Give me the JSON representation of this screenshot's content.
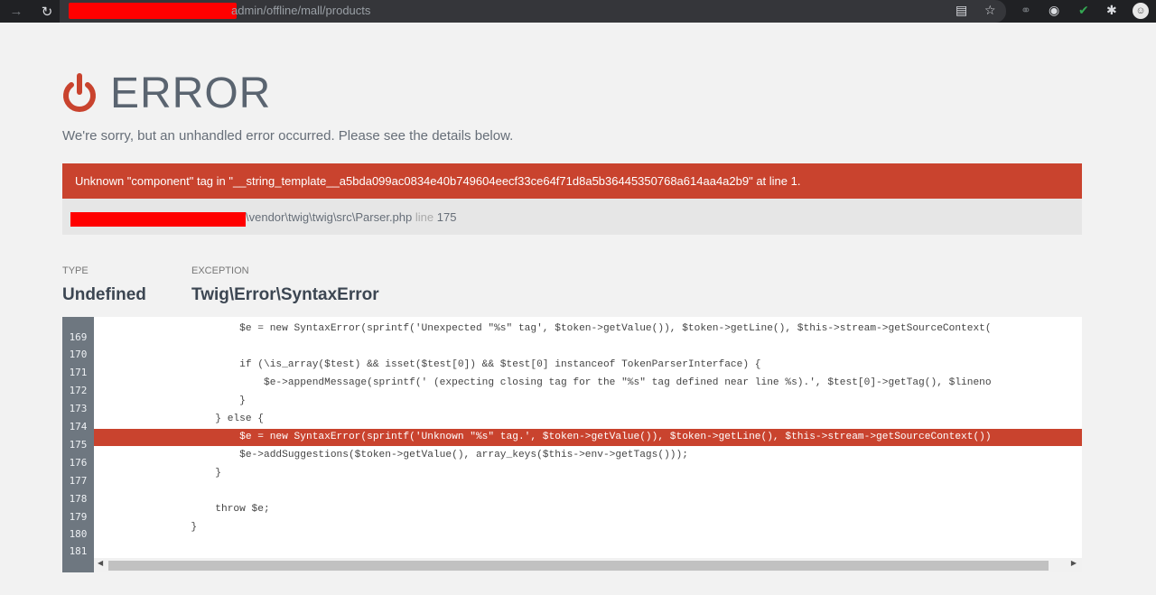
{
  "browser": {
    "url_path": "admin/offline/mall/products",
    "back_icon": "arrow-right",
    "reload_icon": "reload"
  },
  "error": {
    "title": "ERROR",
    "description": "We're sorry, but an unhandled error occurred. Please see the details below.",
    "message": "Unknown \"component\" tag in \"__string_template__a5bda099ac0834e40b749604eecf33ce64f71d8a5b36445350768a614aa4a2b9\" at line 1.",
    "file_path": "\\vendor\\twig\\twig\\src\\Parser.php",
    "line_word": "line",
    "line_number": "175",
    "accent_color": "#c9432e"
  },
  "details": {
    "type_label": "TYPE",
    "type_value": "Undefined",
    "exception_label": "EXCEPTION",
    "exception_value": "Twig\\Error\\SyntaxError"
  },
  "code": {
    "highlight_line": 175,
    "lines": [
      {
        "n": "169",
        "text": "                        $e = new SyntaxError(sprintf('Unexpected \"%s\" tag', $token->getValue()), $token->getLine(), $this->stream->getSourceContext("
      },
      {
        "n": "170",
        "text": ""
      },
      {
        "n": "171",
        "text": "                        if (\\is_array($test) && isset($test[0]) && $test[0] instanceof TokenParserInterface) {"
      },
      {
        "n": "172",
        "text": "                            $e->appendMessage(sprintf(' (expecting closing tag for the \"%s\" tag defined near line %s).', $test[0]->getTag(), $lineno"
      },
      {
        "n": "173",
        "text": "                        }"
      },
      {
        "n": "174",
        "text": "                    } else {"
      },
      {
        "n": "175",
        "text": "                        $e = new SyntaxError(sprintf('Unknown \"%s\" tag.', $token->getValue()), $token->getLine(), $this->stream->getSourceContext())"
      },
      {
        "n": "176",
        "text": "                        $e->addSuggestions($token->getValue(), array_keys($this->env->getTags()));"
      },
      {
        "n": "177",
        "text": "                    }"
      },
      {
        "n": "178",
        "text": ""
      },
      {
        "n": "179",
        "text": "                    throw $e;"
      },
      {
        "n": "180",
        "text": "                }"
      },
      {
        "n": "181",
        "text": ""
      }
    ]
  }
}
